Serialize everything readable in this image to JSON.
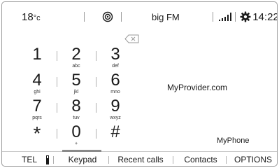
{
  "status": {
    "temperature": "18",
    "temperature_unit": "°c",
    "station": "big FM",
    "time": "14:22"
  },
  "icons": {
    "radio": "radio-icon",
    "signal": "signal-strength-icon",
    "settings": "gear-icon",
    "delete": "backspace-icon",
    "battery": "battery-icon"
  },
  "keypad": {
    "keys": [
      {
        "digit": "1",
        "letters": ""
      },
      {
        "digit": "2",
        "letters": "abc"
      },
      {
        "digit": "3",
        "letters": "def"
      },
      {
        "digit": "4",
        "letters": "ghi"
      },
      {
        "digit": "5",
        "letters": "jkl"
      },
      {
        "digit": "6",
        "letters": "mno"
      },
      {
        "digit": "7",
        "letters": "pqrs"
      },
      {
        "digit": "8",
        "letters": "tuv"
      },
      {
        "digit": "9",
        "letters": "wxyz"
      },
      {
        "digit": "*",
        "letters": ""
      },
      {
        "digit": "0",
        "letters": "+"
      },
      {
        "digit": "#",
        "letters": ""
      }
    ]
  },
  "info": {
    "provider": "MyProvider.com",
    "phone_name": "MyPhone"
  },
  "bottom_bar": {
    "tel": "TEL",
    "keypad": "Keypad",
    "recent_calls": "Recent calls",
    "contacts": "Contacts",
    "options": "OPTIONS"
  }
}
